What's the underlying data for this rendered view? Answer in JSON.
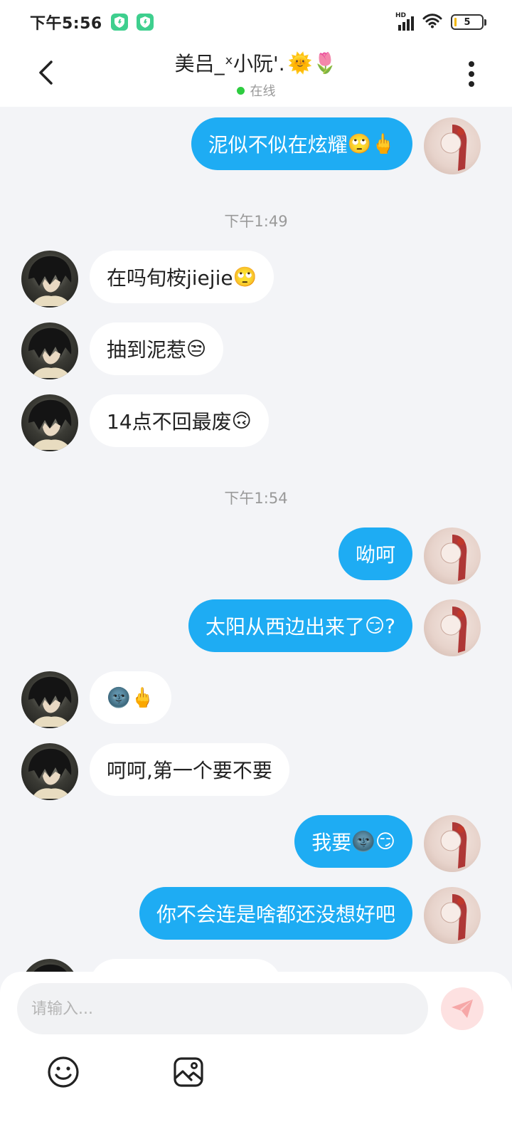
{
  "status_bar": {
    "time": "下午5:56",
    "network": "HD",
    "battery": "5"
  },
  "header": {
    "title_name": "美吕_ˣ小阮'.",
    "title_emojis": "🌞🌷",
    "status": "在线"
  },
  "messages": [
    {
      "side": "self",
      "text": "泥似不似在炫耀",
      "emoji": "🙄🖕"
    },
    {
      "side": "time",
      "text": "下午1:49"
    },
    {
      "side": "other",
      "text": "在吗旬桉jiejie",
      "emoji": "🙄"
    },
    {
      "side": "other",
      "text": "抽到泥惹",
      "emoji": "😒"
    },
    {
      "side": "other",
      "text": "14点不回最废",
      "emoji": "🙃"
    },
    {
      "side": "time",
      "text": "下午1:54"
    },
    {
      "side": "self",
      "text": "呦呵",
      "emoji": ""
    },
    {
      "side": "self",
      "text": "太阳从西边出来了",
      "emoji": "😏",
      "suffix": "?"
    },
    {
      "side": "other",
      "text": "",
      "emoji": "🌚🖕"
    },
    {
      "side": "other",
      "text": "呵呵,第一个要不要",
      "emoji": ""
    },
    {
      "side": "self",
      "text": "我要",
      "emoji": "🌚😏"
    },
    {
      "side": "self",
      "text": "你不会连是啥都还没想好吧",
      "emoji": ""
    }
  ],
  "input": {
    "placeholder": "请输入..."
  },
  "colors": {
    "self_bubble": "#1eacf3",
    "other_bubble": "#ffffff",
    "background": "#f3f4f7",
    "online": "#2ecc40"
  },
  "icons": [
    "back-icon",
    "more-icon",
    "send-icon",
    "emoji-icon",
    "image-icon",
    "wifi-icon",
    "signal-icon",
    "battery-icon"
  ]
}
